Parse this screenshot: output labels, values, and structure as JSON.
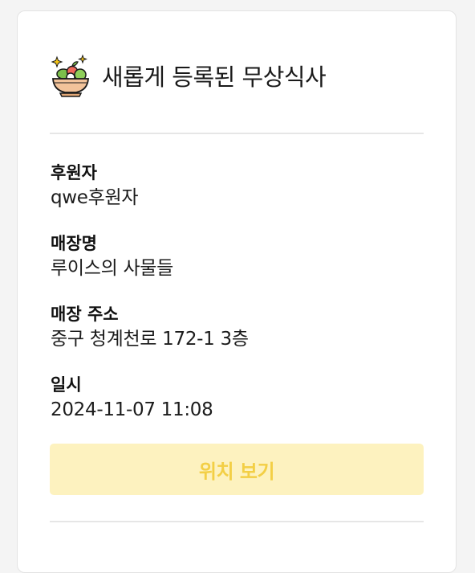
{
  "header": {
    "icon": "salad-bowl-icon",
    "title": "새롭게 등록된 무상식사"
  },
  "details": {
    "sponsor_label": "후원자",
    "sponsor_value": "qwe후원자",
    "store_label": "매장명",
    "store_value": "루이스의 사물들",
    "address_label": "매장 주소",
    "address_value": "중구 청계천로 172-1 3층",
    "datetime_label": "일시",
    "datetime_value": "2024-11-07 11:08"
  },
  "actions": {
    "view_location_label": "위치 보기"
  },
  "colors": {
    "button_bg": "#fdf2bf",
    "button_text": "#f3cf45",
    "divider": "#e6e6e6"
  }
}
